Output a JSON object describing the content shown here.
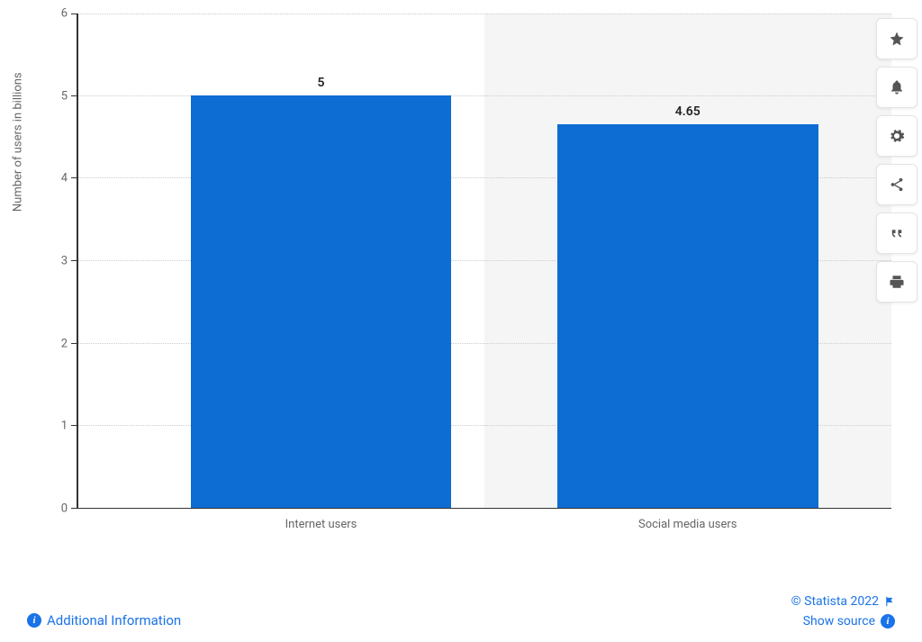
{
  "chart_data": {
    "type": "bar",
    "categories": [
      "Internet users",
      "Social media users"
    ],
    "values": [
      5,
      4.65
    ],
    "ylabel": "Number of users in billions",
    "xlabel": "",
    "ylim": [
      0,
      6
    ],
    "yticks": [
      0,
      1,
      2,
      3,
      4,
      5,
      6
    ],
    "bar_color": "#0d6dd3"
  },
  "footer": {
    "additional_info": "Additional Information",
    "copyright": "© Statista 2022",
    "show_source": "Show source"
  },
  "toolbar": {
    "star": "star",
    "bell": "bell",
    "gear": "gear",
    "share": "share",
    "quote": "quote",
    "print": "print"
  }
}
